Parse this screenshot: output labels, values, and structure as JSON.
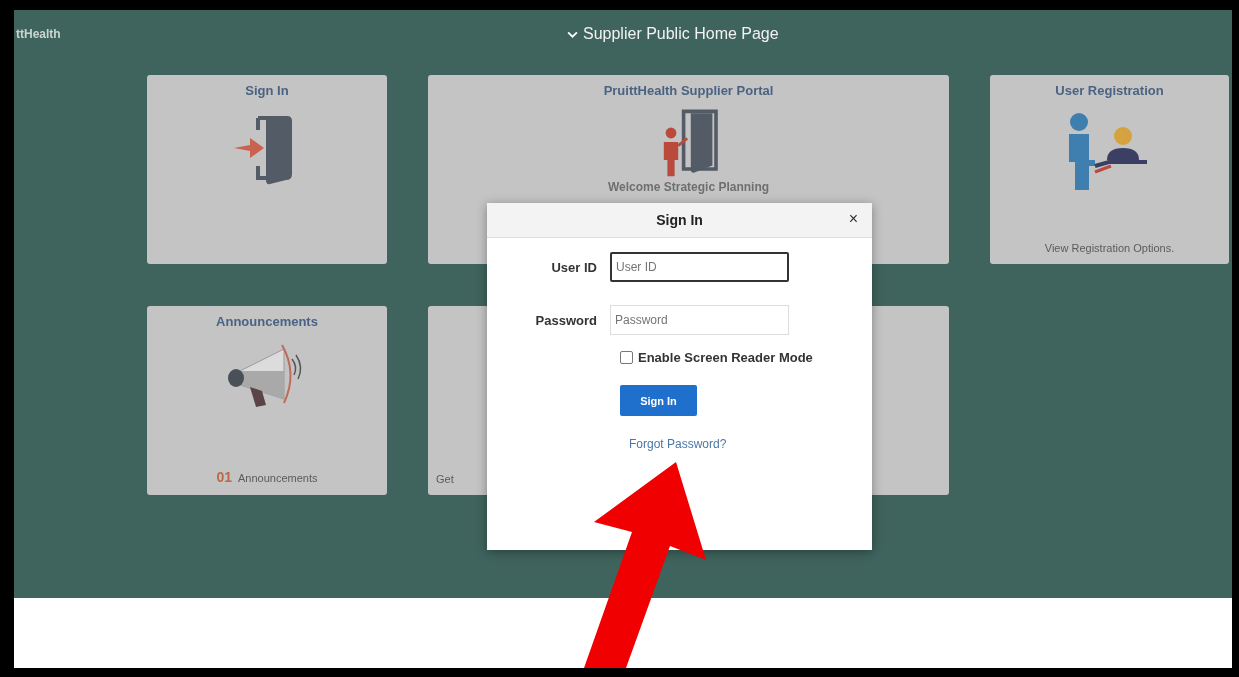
{
  "header": {
    "logo": "ttHealth",
    "title": "Supplier Public Home Page"
  },
  "tiles": [
    {
      "kind": "signin",
      "title": "Sign In"
    },
    {
      "kind": "portal",
      "title": "PruittHealth Supplier Portal",
      "subtitle": "Welcome Strategic Planning"
    },
    {
      "kind": "registration",
      "title": "User Registration",
      "footer": "View Registration Options."
    },
    {
      "kind": "announcements",
      "title": "Announcements",
      "count": "01",
      "footer": "Announcements"
    },
    {
      "kind": "blank",
      "footer": "Get"
    }
  ],
  "dialog": {
    "title": "Sign In",
    "close": "×",
    "fields": [
      {
        "label": "User ID",
        "placeholder": "User ID",
        "focused": true
      },
      {
        "label": "Password",
        "placeholder": "Password",
        "focused": false
      }
    ],
    "checkbox": {
      "label": "Enable Screen Reader Mode",
      "checked": false
    },
    "button": "Sign In",
    "link": "Forgot Password?"
  }
}
